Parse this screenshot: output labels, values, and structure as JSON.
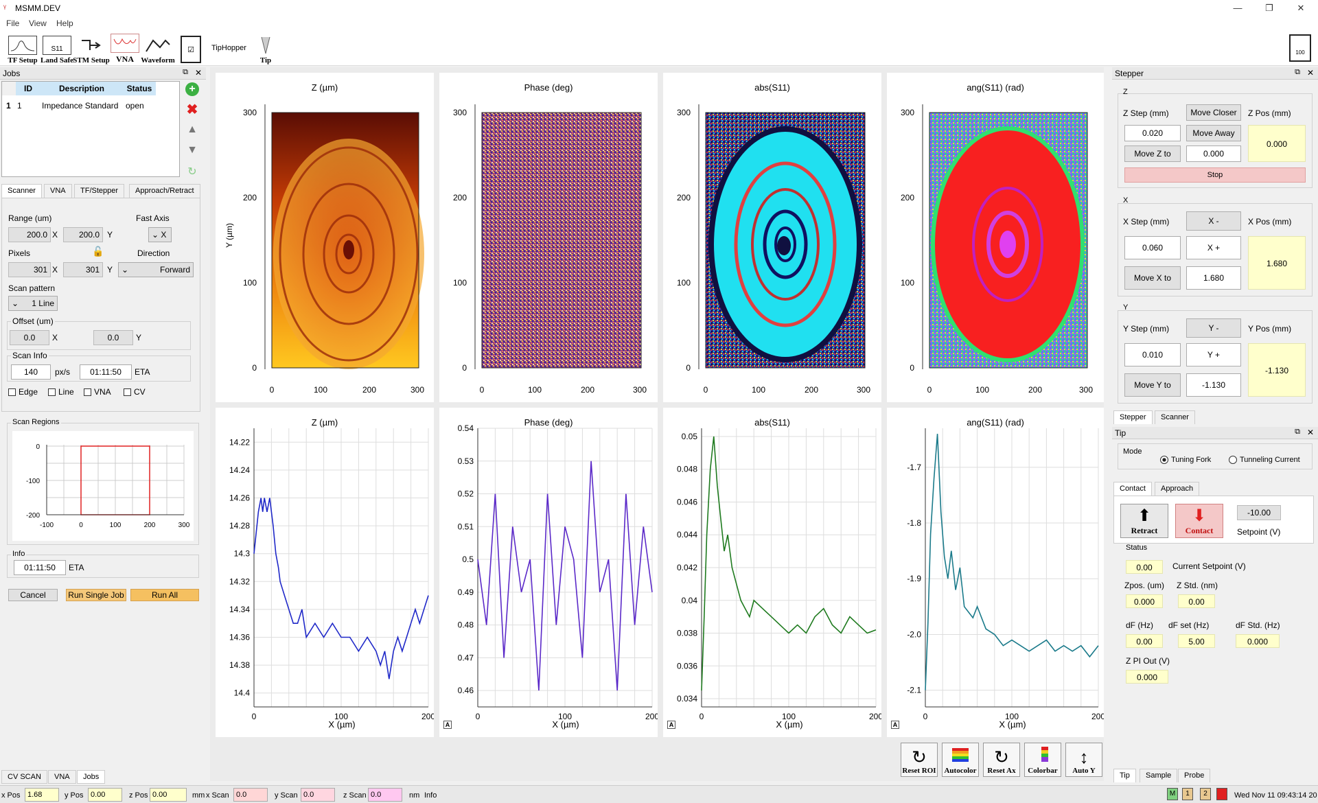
{
  "window": {
    "title": "MSMM.DEV"
  },
  "menu": [
    "File",
    "View",
    "Help"
  ],
  "toolbar": [
    {
      "label": "TF Setup",
      "icon": "tf-setup-icon"
    },
    {
      "label": "Land Safe",
      "icon": "land-safe-icon",
      "sub": "S11"
    },
    {
      "label": "STM Setup",
      "icon": "stm-setup-icon"
    },
    {
      "label": "VNA",
      "icon": "vna-icon"
    },
    {
      "label": "Waveform",
      "icon": "waveform-icon"
    },
    {
      "label": "",
      "icon": "checklist-icon"
    },
    {
      "label": "TipHopper",
      "icon": ""
    },
    {
      "label": "Tip",
      "icon": "tip-icon"
    },
    {
      "label": "100",
      "icon": "document-icon"
    }
  ],
  "jobs": {
    "title": "Jobs",
    "columns": [
      "ID",
      "Description",
      "Status"
    ],
    "rows": [
      {
        "row": "1",
        "id": "1",
        "description": "Impedance Standard",
        "status": "open"
      }
    ]
  },
  "scanner_tabs": [
    "Scanner",
    "VNA",
    "TF/Stepper",
    "Approach/Retract"
  ],
  "scanner": {
    "range_label": "Range (um)",
    "range_x": "200.0",
    "range_y": "200.0",
    "fast_axis_label": "Fast Axis",
    "fast_axis": "X",
    "pixels_label": "Pixels",
    "pixels_x": "301",
    "pixels_y": "301",
    "direction_label": "Direction",
    "direction": "Forward",
    "x": "X",
    "y": "Y",
    "scan_pattern_label": "Scan pattern",
    "scan_pattern": "1 Line",
    "offset_label": "Offset (um)",
    "offset_x": "0.0",
    "offset_y": "0.0",
    "scan_info_label": "Scan Info",
    "speed": "140",
    "speed_unit": "px/s",
    "eta": "01:11:50",
    "eta_label": "ETA",
    "checks": [
      "Edge",
      "Line",
      "VNA",
      "CV"
    ]
  },
  "scan_regions": {
    "title": "Scan Regions",
    "x_ticks": [
      "-100",
      "0",
      "100",
      "200",
      "300"
    ],
    "y_ticks": [
      "0",
      "-100",
      "-200"
    ]
  },
  "info": {
    "label": "Info",
    "eta": "01:11:50",
    "eta_label": "ETA"
  },
  "actions": {
    "cancel": "Cancel",
    "run_single": "Run Single Job",
    "run_all": "Run All"
  },
  "bottom_tabs_left": [
    "CV SCAN",
    "VNA",
    "Jobs"
  ],
  "image_plots": [
    {
      "title": "Z (µm)",
      "ylabel": "Y (µm)",
      "xticks": [
        "0",
        "100",
        "200",
        "300"
      ],
      "yticks": [
        "300",
        "200",
        "100",
        "0"
      ]
    },
    {
      "title": "Phase (deg)",
      "xticks": [
        "0",
        "100",
        "200",
        "300"
      ],
      "yticks": [
        "300",
        "200",
        "100",
        "0"
      ]
    },
    {
      "title": "abs(S11)",
      "xticks": [
        "0",
        "100",
        "200",
        "300"
      ],
      "yticks": [
        "300",
        "200",
        "100",
        "0"
      ]
    },
    {
      "title": "ang(S11) (rad)",
      "xticks": [
        "0",
        "100",
        "200",
        "300"
      ],
      "yticks": [
        "300",
        "200",
        "100",
        "0"
      ]
    }
  ],
  "chart_data": [
    {
      "type": "line",
      "title": "Z (µm)",
      "xlabel": "X (µm)",
      "ylabel": "",
      "xlim": [
        0,
        200
      ],
      "ylim": [
        14.41,
        14.21
      ],
      "inverted_y": true,
      "yticks": [
        "14.22",
        "14.24",
        "14.26",
        "14.28",
        "14.3",
        "14.32",
        "14.34",
        "14.36",
        "14.38",
        "14.4"
      ],
      "xticks": [
        "0",
        "100",
        "200"
      ],
      "color": "#1f28c8",
      "x": [
        0,
        5,
        8,
        10,
        12,
        15,
        18,
        20,
        22,
        25,
        28,
        30,
        35,
        40,
        45,
        50,
        55,
        60,
        70,
        80,
        90,
        100,
        110,
        120,
        130,
        140,
        145,
        150,
        155,
        160,
        165,
        170,
        175,
        180,
        185,
        190,
        195,
        200
      ],
      "y": [
        14.3,
        14.27,
        14.26,
        14.27,
        14.26,
        14.27,
        14.26,
        14.27,
        14.28,
        14.3,
        14.31,
        14.32,
        14.33,
        14.34,
        14.35,
        14.35,
        14.34,
        14.36,
        14.35,
        14.36,
        14.35,
        14.36,
        14.36,
        14.37,
        14.36,
        14.37,
        14.38,
        14.37,
        14.39,
        14.37,
        14.36,
        14.37,
        14.36,
        14.35,
        14.34,
        14.35,
        14.34,
        14.33
      ]
    },
    {
      "type": "line",
      "title": "Phase (deg)",
      "xlabel": "X (µm)",
      "ylabel": "",
      "xlim": [
        0,
        200
      ],
      "ylim": [
        0.455,
        0.54
      ],
      "yticks": [
        "0.54",
        "0.53",
        "0.52",
        "0.51",
        "0.5",
        "0.49",
        "0.48",
        "0.47",
        "0.46"
      ],
      "xticks": [
        "0",
        "100",
        "200"
      ],
      "color": "#5a28c8",
      "x": [
        0,
        10,
        20,
        30,
        40,
        50,
        60,
        70,
        80,
        90,
        100,
        110,
        120,
        130,
        140,
        150,
        160,
        170,
        180,
        190,
        200
      ],
      "y": [
        0.5,
        0.48,
        0.52,
        0.47,
        0.51,
        0.49,
        0.5,
        0.46,
        0.52,
        0.48,
        0.51,
        0.5,
        0.47,
        0.53,
        0.49,
        0.5,
        0.46,
        0.52,
        0.48,
        0.51,
        0.49
      ]
    },
    {
      "type": "line",
      "title": "abs(S11)",
      "xlabel": "X (µm)",
      "ylabel": "",
      "xlim": [
        0,
        200
      ],
      "ylim": [
        0.0335,
        0.0505
      ],
      "yticks": [
        "0.05",
        "0.048",
        "0.046",
        "0.044",
        "0.042",
        "0.04",
        "0.038",
        "0.036",
        "0.034"
      ],
      "xticks": [
        "0",
        "100",
        "200"
      ],
      "color": "#1e7a1e",
      "x": [
        0,
        3,
        6,
        10,
        14,
        18,
        22,
        26,
        30,
        35,
        40,
        45,
        50,
        55,
        60,
        70,
        80,
        90,
        100,
        110,
        120,
        130,
        140,
        150,
        160,
        170,
        180,
        190,
        200
      ],
      "y": [
        0.0345,
        0.039,
        0.044,
        0.048,
        0.05,
        0.047,
        0.045,
        0.043,
        0.044,
        0.042,
        0.041,
        0.04,
        0.0395,
        0.039,
        0.04,
        0.0395,
        0.039,
        0.0385,
        0.038,
        0.0385,
        0.038,
        0.039,
        0.0395,
        0.0385,
        0.038,
        0.039,
        0.0385,
        0.038,
        0.0382
      ]
    },
    {
      "type": "line",
      "title": "ang(S11) (rad)",
      "xlabel": "X (µm)",
      "ylabel": "",
      "xlim": [
        0,
        200
      ],
      "ylim": [
        -2.13,
        -1.63
      ],
      "yticks": [
        "-1.7",
        "-1.8",
        "-1.9",
        "-2.0",
        "-2.1"
      ],
      "xticks": [
        "0",
        "100",
        "200"
      ],
      "color": "#1a7a8a",
      "x": [
        0,
        3,
        6,
        10,
        14,
        18,
        22,
        26,
        30,
        35,
        40,
        45,
        50,
        55,
        60,
        70,
        80,
        90,
        100,
        110,
        120,
        130,
        140,
        150,
        160,
        170,
        180,
        190,
        200
      ],
      "y": [
        -2.1,
        -1.98,
        -1.82,
        -1.72,
        -1.64,
        -1.78,
        -1.86,
        -1.9,
        -1.85,
        -1.92,
        -1.88,
        -1.95,
        -1.96,
        -1.97,
        -1.95,
        -1.99,
        -2.0,
        -2.02,
        -2.01,
        -2.02,
        -2.03,
        -2.02,
        -2.01,
        -2.03,
        -2.02,
        -2.03,
        -2.02,
        -2.04,
        -2.02
      ]
    }
  ],
  "plot_toolbar": [
    "Reset ROI",
    "Autocolor",
    "Reset Ax",
    "Colorbar",
    "Auto Y"
  ],
  "stepper": {
    "title": "Stepper",
    "z_group": "Z",
    "z_step_label": "Z Step (mm)",
    "z_step": "0.020",
    "move_closer": "Move Closer",
    "move_away": "Move Away",
    "move_z_to": "Move Z to",
    "z_to": "0.000",
    "z_pos_label": "Z Pos (mm)",
    "z_pos": "0.000",
    "stop": "Stop",
    "x_group": "X",
    "x_step_label": "X Step (mm)",
    "x_step": "0.060",
    "x_minus": "X -",
    "x_plus": "X +",
    "move_x_to": "Move X to",
    "x_to": "1.680",
    "x_pos_label": "X Pos (mm)",
    "x_pos": "1.680",
    "y_group": "Y",
    "y_step_label": "Y Step (mm)",
    "y_step": "0.010",
    "y_minus": "Y -",
    "y_plus": "Y +",
    "move_y_to": "Move Y to",
    "y_to": "-1.130",
    "y_pos_label": "Y Pos (mm)",
    "y_pos": "-1.130",
    "tabs": [
      "Stepper",
      "Scanner"
    ]
  },
  "tip": {
    "title": "Tip",
    "mode_label": "Mode",
    "mode_options": [
      "Tuning Fork",
      "Tunneling Current"
    ],
    "mode_selected": "Tuning Fork",
    "tabs": [
      "Contact",
      "Approach"
    ],
    "retract": "Retract",
    "contact": "Contact",
    "setpoint": "-10.00",
    "setpoint_label": "Setpoint (V)",
    "status_label": "Status",
    "current_setpoint": "0.00",
    "current_setpoint_label": "Current Setpoint (V)",
    "zpos_label": "Zpos. (um)",
    "zpos": "0.000",
    "zstd_label": "Z Std. (nm)",
    "zstd": "0.00",
    "df_label": "dF (Hz)",
    "df": "0.00",
    "dfset_label": "dF set (Hz)",
    "dfset": "5.00",
    "dfstd_label": "dF Std. (Hz)",
    "dfstd": "0.000",
    "zpi_label": "Z PI Out (V)",
    "zpi": "0.000",
    "bottom_tabs": [
      "Tip",
      "Sample",
      "Probe"
    ]
  },
  "statusbar": {
    "xpos_label": "x Pos",
    "xpos": "1.68",
    "ypos_label": "y Pos",
    "ypos": "0.00",
    "zpos_label": "z Pos",
    "zpos": "0.00",
    "mm": "mm",
    "xscan_label": "x Scan",
    "xscan": "0.0",
    "yscan_label": "y Scan",
    "yscan": "0.0",
    "zscan_label": "z Scan",
    "zscan": "0.0",
    "nm": "nm",
    "info": "Info",
    "badges": [
      "M",
      "1",
      "2"
    ],
    "datetime": "Wed Nov 11 09:43:14 20",
    "colors": {
      "xscan": "#ffd6d6",
      "yscan": "#ffd6e0",
      "zscan": "#ffc8f0",
      "m": "#7fd07f",
      "one": "#e8c890",
      "two": "#e8c890",
      "red": "#e02020"
    }
  }
}
